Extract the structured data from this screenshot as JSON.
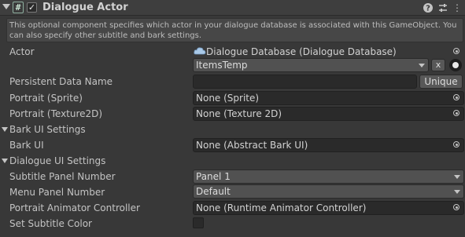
{
  "component": {
    "title": "Dialogue Actor",
    "enabled_mark": "✓",
    "script_icon": "#",
    "help_icon": "?",
    "presets_icon": "⇄",
    "menu_icon": "⋮"
  },
  "help_text": "This optional component specifies which actor in your dialogue database is associated with this GameObject. You can also specify other subtitle and bark settings.",
  "actor": {
    "label": "Actor",
    "database_icon": "cloud-icon",
    "database_value": "Dialogue Database (Dialogue Database)",
    "selected_actor": "ItemsTemp",
    "clear_button": "x"
  },
  "persistent_data_name": {
    "label": "Persistent Data Name",
    "value": "",
    "unique_button": "Unique"
  },
  "portrait_sprite": {
    "label": "Portrait (Sprite)",
    "value": "None (Sprite)"
  },
  "portrait_texture": {
    "label": "Portrait (Texture2D)",
    "value": "None (Texture 2D)"
  },
  "bark_section": {
    "label": "Bark UI Settings",
    "bark_ui_label": "Bark UI",
    "bark_ui_value": "None (Abstract Bark UI)"
  },
  "dialogue_section": {
    "label": "Dialogue UI Settings",
    "subtitle_panel_label": "Subtitle Panel Number",
    "subtitle_panel_value": "Panel 1",
    "menu_panel_label": "Menu Panel Number",
    "menu_panel_value": "Default",
    "animator_label": "Portrait Animator Controller",
    "animator_value": "None (Runtime Animator Controller)",
    "subtitle_color_label": "Set Subtitle Color",
    "subtitle_color_checked": false
  },
  "colors": {
    "background": "#383838",
    "field": "#2a2a2a",
    "popup": "#515151",
    "text": "#c4c4c4"
  }
}
